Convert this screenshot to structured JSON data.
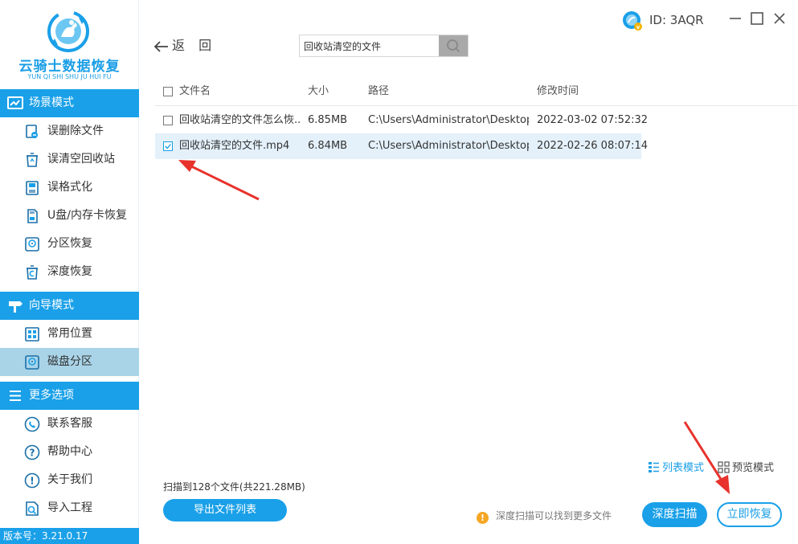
{
  "app": {
    "name": "云骑士数据恢复",
    "name_pinyin": "YUN QI SHI SHU JU HUI FU",
    "version": "版本号：3.21.0.17",
    "accent_color": "#1aa0e8"
  },
  "sidebar": {
    "sections": [
      {
        "title": "场景模式",
        "icon": "scene-icon",
        "items": [
          {
            "label": "误删除文件",
            "icon": "deleted-file-icon"
          },
          {
            "label": "误清空回收站",
            "icon": "recycle-bin-icon"
          },
          {
            "label": "误格式化",
            "icon": "format-icon"
          },
          {
            "label": "U盘/内存卡恢复",
            "icon": "usb-card-icon"
          },
          {
            "label": "分区恢复",
            "icon": "partition-icon"
          },
          {
            "label": "深度恢复",
            "icon": "deep-recovery-icon"
          }
        ]
      },
      {
        "title": "向导模式",
        "icon": "signpost-icon",
        "items": [
          {
            "label": "常用位置",
            "icon": "common-location-icon"
          },
          {
            "label": "磁盘分区",
            "icon": "disk-partition-icon",
            "active": true
          }
        ]
      },
      {
        "title": "更多选项",
        "icon": "menu-icon",
        "items": [
          {
            "label": "联系客服",
            "icon": "phone-icon"
          },
          {
            "label": "帮助中心",
            "icon": "help-icon"
          },
          {
            "label": "关于我们",
            "icon": "info-icon"
          },
          {
            "label": "导入工程",
            "icon": "import-icon"
          }
        ]
      }
    ]
  },
  "topbar": {
    "back_label": "返 回",
    "search_value": "回收站清空的文件",
    "user_id": "ID: 3AQR"
  },
  "table": {
    "columns": [
      "文件名",
      "大小",
      "路径",
      "修改时间"
    ],
    "rows": [
      {
        "name": "回收站清空的文件怎么恢...",
        "size": "6.85MB",
        "path": "C:\\Users\\Administrator\\Desktop...",
        "modified": "2022-03-02 07:52:32",
        "checked": false
      },
      {
        "name": "回收站清空的文件.mp4",
        "size": "6.84MB",
        "path": "C:\\Users\\Administrator\\Desktop",
        "modified": "2022-02-26 08:07:14",
        "checked": true
      }
    ]
  },
  "footer": {
    "view_list": "列表模式",
    "view_preview": "预览模式",
    "scan_summary": "扫描到128个文件(共221.28MB)",
    "export_button": "导出文件列表",
    "hint": "深度扫描可以找到更多文件",
    "deep_scan_button": "深度扫描",
    "recover_button": "立即恢复"
  }
}
